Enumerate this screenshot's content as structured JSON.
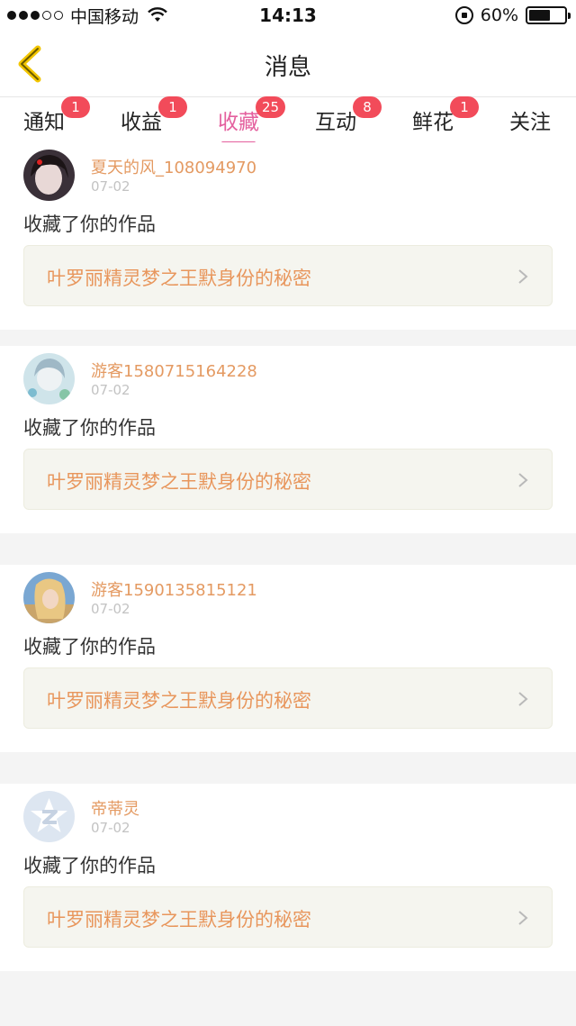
{
  "status_bar": {
    "carrier": "中国移动",
    "time": "14:13",
    "battery": "60%",
    "battery_level": 0.6
  },
  "nav": {
    "title": "消息"
  },
  "tabs": [
    {
      "label": "通知",
      "badge": "1"
    },
    {
      "label": "收益",
      "badge": "1"
    },
    {
      "label": "收藏",
      "badge": "25",
      "active": true
    },
    {
      "label": "互动",
      "badge": "8"
    },
    {
      "label": "鲜花",
      "badge": "1"
    },
    {
      "label": "关注",
      "badge": ""
    }
  ],
  "feed": [
    {
      "username": "夏天的风_108094970",
      "date": "07-02",
      "action": "收藏了你的作品",
      "work_title": "叶罗丽精灵梦之王默身份的秘密"
    },
    {
      "username": "游客1580715164228",
      "date": "07-02",
      "action": "收藏了你的作品",
      "work_title": "叶罗丽精灵梦之王默身份的秘密"
    },
    {
      "username": "游客1590135815121",
      "date": "07-02",
      "action": "收藏了你的作品",
      "work_title": "叶罗丽精灵梦之王默身份的秘密"
    },
    {
      "username": "帝蒂灵",
      "date": "07-02",
      "action": "收藏了你的作品",
      "work_title": "叶罗丽精灵梦之王默身份的秘密"
    }
  ],
  "colors": {
    "accent": "#e4609e",
    "badge": "#f24b5a",
    "username": "#e49a62",
    "work_title": "#e8965c",
    "back_icon": "#f2c500"
  }
}
